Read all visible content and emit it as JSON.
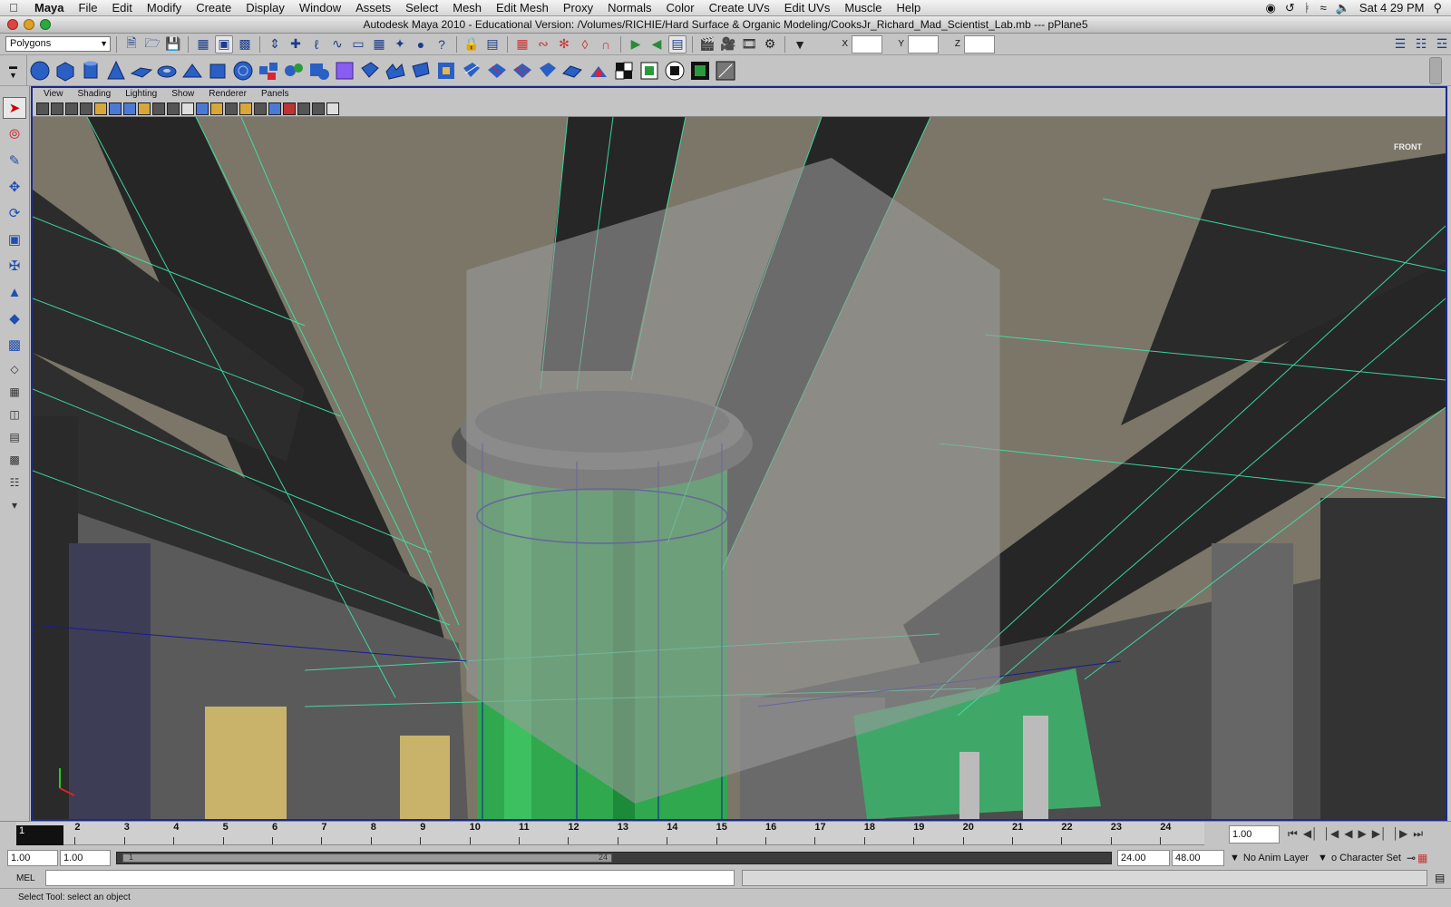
{
  "menubar": {
    "app_name": "Maya",
    "items": [
      "File",
      "Edit",
      "Modify",
      "Create",
      "Display",
      "Window",
      "Assets",
      "Select",
      "Mesh",
      "Edit Mesh",
      "Proxy",
      "Normals",
      "Color",
      "Create UVs",
      "Edit UVs",
      "Muscle",
      "Help"
    ],
    "clock": "Sat 4 29 PM"
  },
  "window": {
    "title": "Autodesk Maya 2010 - Educational Version: /Volumes/RICHIE/Hard Surface & Organic Modeling/CooksJr_Richard_Mad_Scientist_Lab.mb   ---   pPlane5"
  },
  "status_line": {
    "menu_set": "Polygons",
    "coord_labels": {
      "x": "X",
      "y": "Y",
      "z": "Z"
    }
  },
  "panel": {
    "menu": [
      "View",
      "Shading",
      "Lighting",
      "Show",
      "Renderer",
      "Panels"
    ],
    "viewcube_label": "FRONT"
  },
  "timeline": {
    "current_frame": "1",
    "ticks": [
      "1",
      "2",
      "3",
      "4",
      "5",
      "6",
      "7",
      "8",
      "9",
      "10",
      "11",
      "12",
      "13",
      "14",
      "15",
      "16",
      "17",
      "18",
      "19",
      "20",
      "21",
      "22",
      "23",
      "24"
    ],
    "current_time": "1.00"
  },
  "range": {
    "start": "1.00",
    "playback_start": "1.00",
    "handle_start": "1",
    "handle_end": "24",
    "playback_end": "24.00",
    "end": "48.00",
    "anim_layer": "No Anim Layer",
    "character_set": "o Character Set"
  },
  "command_line": {
    "label": "MEL"
  },
  "help_line": {
    "text": "Select Tool: select an object"
  },
  "colors": {
    "viewport_frame": "#1c2a8c",
    "wireframe_green": "#3ce6a8",
    "selection_blue": "#1a1a9a",
    "ceiling": "#7b7667",
    "cylinder_green": "#2fa84e"
  }
}
